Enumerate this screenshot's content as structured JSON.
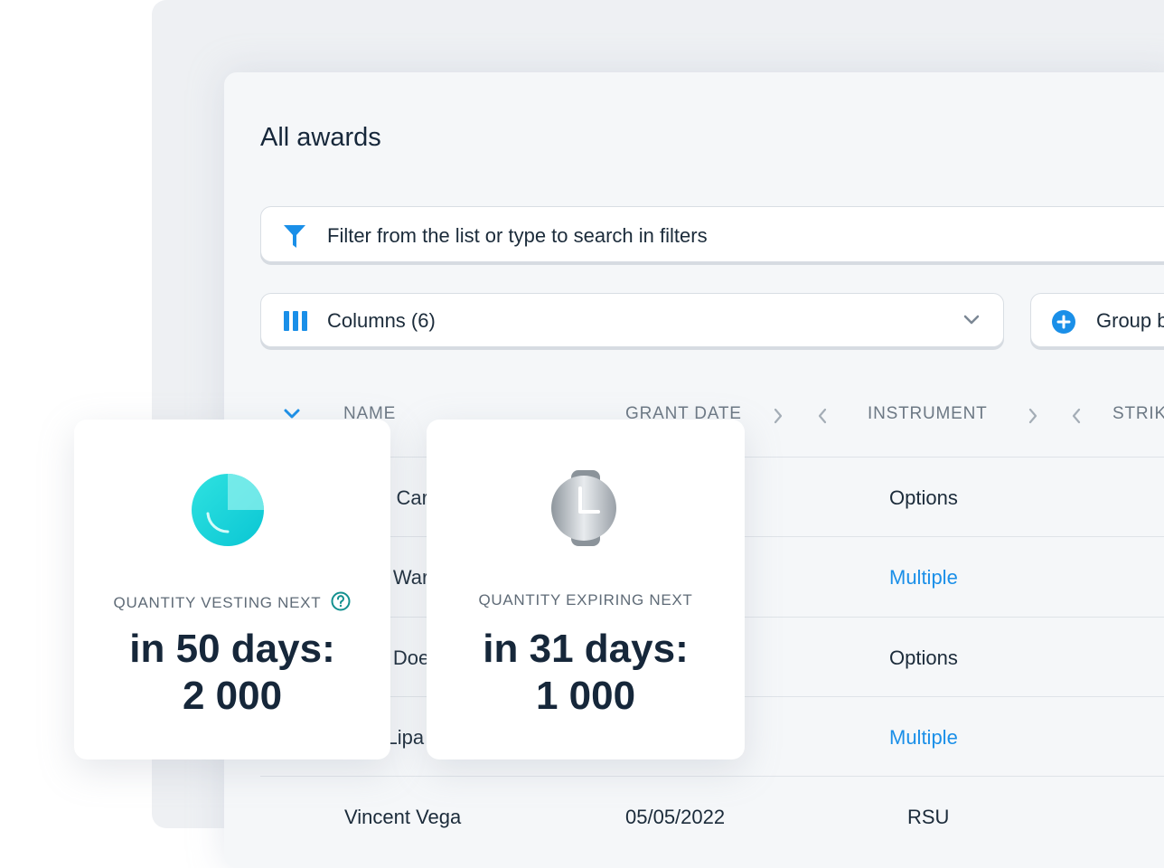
{
  "page": {
    "title": "All awards"
  },
  "filter": {
    "placeholder": "Filter from the list or type to search in filters"
  },
  "columns_button": {
    "label": "Columns (6)"
  },
  "group_button": {
    "label": "Group by"
  },
  "table": {
    "headers": [
      "NAME",
      "GRANT DATE",
      "INSTRUMENT",
      "STRIKE"
    ],
    "rows": [
      {
        "name": "Brian Carter",
        "grant_date": "",
        "instrument": "Options",
        "instrument_link": false
      },
      {
        "name": "Jane Warren",
        "grant_date": "",
        "instrument": "Multiple",
        "instrument_link": true
      },
      {
        "name": "John Doe",
        "grant_date": "",
        "instrument": "Options",
        "instrument_link": false
      },
      {
        "name": "Dua Lipa",
        "grant_date": "",
        "instrument": "Multiple",
        "instrument_link": true
      },
      {
        "name": "Vincent Vega",
        "grant_date": "05/05/2022",
        "instrument": "RSU",
        "instrument_link": false
      }
    ]
  },
  "cards": {
    "vesting": {
      "label": "QUANTITY VESTING NEXT",
      "line1": "in 50 days:",
      "line2": "2 000",
      "icon": "pie-chart-icon"
    },
    "expiring": {
      "label": "QUANTITY EXPIRING NEXT",
      "line1": "in 31 days:",
      "line2": "1 000",
      "icon": "watch-icon"
    }
  },
  "colors": {
    "accent": "#1a8fe8",
    "teal": "#14d2d6",
    "text": "#16273a"
  }
}
